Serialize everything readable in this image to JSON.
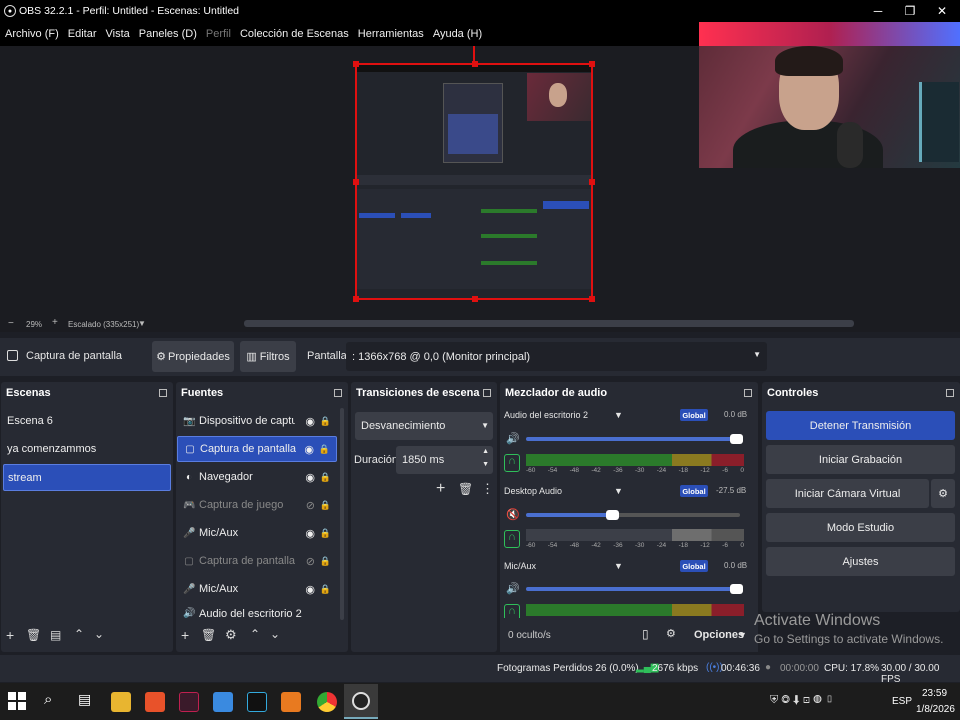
{
  "window": {
    "title": "OBS 32.2.1 - Perfil: Untitled - Escenas: Untitled",
    "minimize": "─",
    "maximize": "❐",
    "close": "✕"
  },
  "menu": [
    "Archivo (F)",
    "Editar",
    "Vista",
    "Paneles (D)",
    "Perfil",
    "Colección de Escenas",
    "Herramientas",
    "Ayuda (H)"
  ],
  "zoom": {
    "minus": "−",
    "value": "29%",
    "plus": "+",
    "scaling": "Escalado (335x251)",
    "arrow": "▼"
  },
  "source_bar": {
    "source": "Captura de pantalla",
    "properties": "Propiedades",
    "filters": "Filtros",
    "display_label": "Pantalla",
    "display_value": ": 1366x768 @ 0,0 (Monitor principal)"
  },
  "scenes": {
    "title": "Escenas",
    "items": [
      "Escena 6",
      "ya comenzammos",
      "stream"
    ],
    "selected": 2
  },
  "sources": {
    "title": "Fuentes",
    "items": [
      {
        "label": "Dispositivo de captura d",
        "icon": "📷",
        "visible": true
      },
      {
        "label": "Captura de pantalla",
        "icon": "▢",
        "visible": true
      },
      {
        "label": "Navegador",
        "icon": "◐",
        "visible": true
      },
      {
        "label": "Captura de juego",
        "icon": "🎮",
        "visible": false
      },
      {
        "label": "Mic/Aux",
        "icon": "🎤",
        "visible": true
      },
      {
        "label": "Captura de pantalla",
        "icon": "▢",
        "visible": false
      },
      {
        "label": "Mic/Aux",
        "icon": "🎤",
        "visible": true
      },
      {
        "label": "Audio del escritorio 2",
        "icon": "🔊",
        "visible": true
      }
    ]
  },
  "transitions": {
    "title": "Transiciones de escena",
    "selected": "Desvanecimiento",
    "duration_label": "Duración",
    "duration_value": "1850 ms"
  },
  "mixer": {
    "title": "Mezclador de audio",
    "hidden": "0 oculto/s",
    "options": "Opciones",
    "ticks": [
      "-60",
      "-54",
      "-48",
      "-42",
      "-36",
      "-30",
      "-24",
      "-18",
      "-12",
      "-6",
      "0"
    ],
    "channels": [
      {
        "name": "Audio del escritorio 2",
        "global": "Global",
        "db": "0.0 dB",
        "level": 1.0,
        "muted": false
      },
      {
        "name": "Desktop Audio",
        "global": "Global",
        "db": "-27.5 dB",
        "level": 0.4,
        "muted": true
      },
      {
        "name": "Mic/Aux",
        "global": "Global",
        "db": "0.0 dB",
        "level": 1.0,
        "muted": false
      }
    ]
  },
  "controls": {
    "title": "Controles",
    "stop_stream": "Detener Transmisión",
    "start_recording": "Iniciar Grabación",
    "start_virtual_cam": "Iniciar Cámara Virtual",
    "studio_mode": "Modo Estudio",
    "settings": "Ajustes"
  },
  "status": {
    "dropped": "Fotogramas Perdidos 26 (0.0%)",
    "bitrate": "2676 kbps",
    "stream_time": "00:46:36",
    "rec_time": "00:00:00",
    "cpu": "CPU: 17.8%",
    "fps": "30.00 / 30.00 FPS"
  },
  "activate": {
    "line1": "Activate Windows",
    "line2": "Go to Settings to activate Windows."
  },
  "taskbar": {
    "lang": "ESP",
    "time": "23:59",
    "date": "1/8/2026"
  },
  "colors": {
    "accent": "#2b4fb8",
    "record_red": "#e01010"
  }
}
